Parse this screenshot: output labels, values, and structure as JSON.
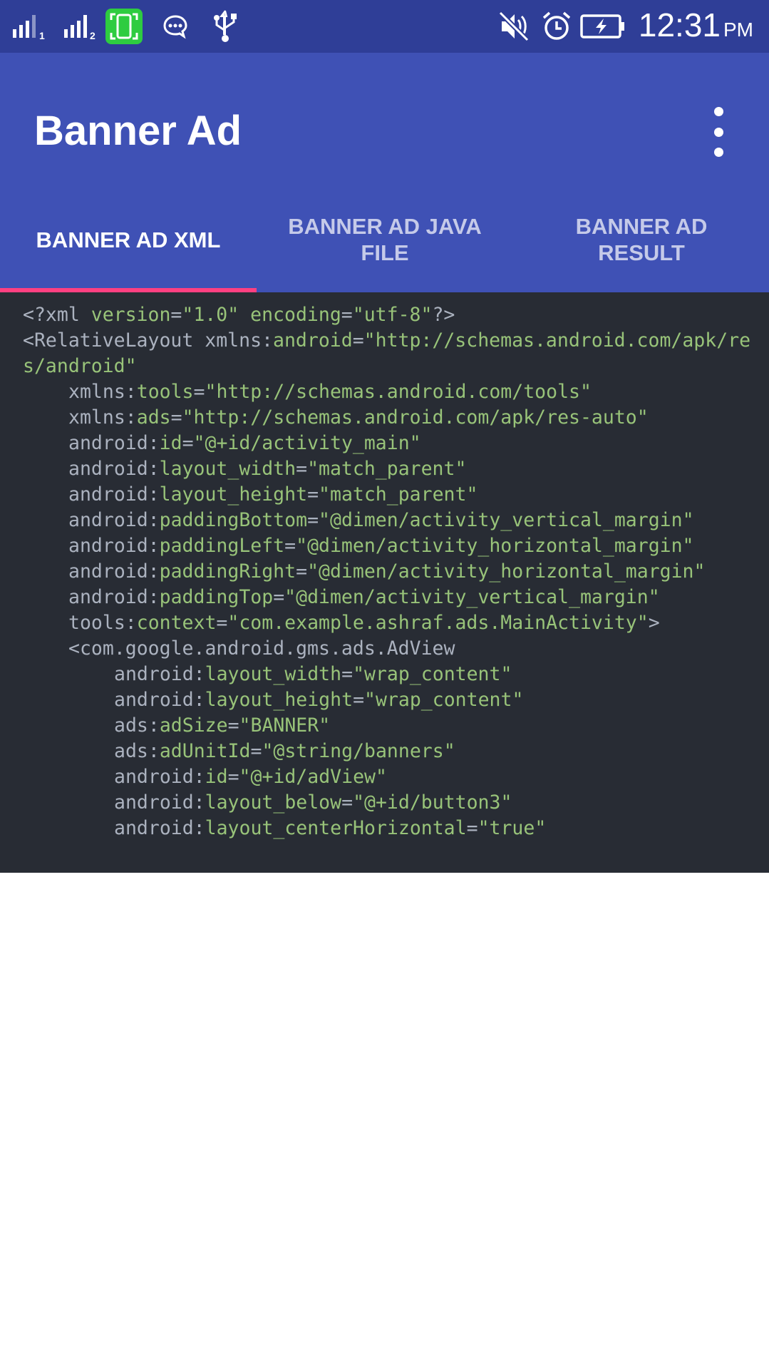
{
  "status_bar": {
    "time": "12:31",
    "ampm": "PM",
    "icons": [
      "signal-1-icon",
      "signal-2-icon",
      "screen-mirror-icon",
      "message-icon",
      "usb-icon",
      "mute-icon",
      "alarm-icon",
      "battery-charging-icon"
    ]
  },
  "app_bar": {
    "title": "Banner Ad",
    "menu_icon": "more-vert-icon"
  },
  "tabs": [
    {
      "label": "BANNER AD XML",
      "active": true
    },
    {
      "label": "BANNER AD JAVA\nFILE",
      "active": false
    },
    {
      "label": "BANNER AD\nRESULT",
      "active": false
    }
  ],
  "colors": {
    "status_bar": "#2f3e97",
    "app_bar": "#3f51b5",
    "tab_indicator": "#ff4081",
    "code_bg": "#282c34",
    "code_text": "#abb2bf",
    "code_attr": "#98c379"
  },
  "code_lines": [
    {
      "indent": "",
      "parts": [
        [
          "plain",
          "<?xml "
        ],
        [
          "attr",
          "version"
        ],
        [
          "plain",
          "="
        ],
        [
          "val",
          "\"1.0\""
        ],
        [
          "plain",
          " "
        ],
        [
          "attr",
          "encoding"
        ],
        [
          "plain",
          "="
        ],
        [
          "val",
          "\"utf-8\""
        ],
        [
          "plain",
          "?>"
        ]
      ]
    },
    {
      "indent": "",
      "parts": [
        [
          "plain",
          "<RelativeLayout xmlns:"
        ],
        [
          "attr",
          "android"
        ],
        [
          "plain",
          "="
        ],
        [
          "val",
          "\"http://schemas.android.com/apk/res/android\""
        ]
      ]
    },
    {
      "indent": "    ",
      "parts": [
        [
          "plain",
          "xmlns:"
        ],
        [
          "attr",
          "tools"
        ],
        [
          "plain",
          "="
        ],
        [
          "val",
          "\"http://schemas.android.com/tools\""
        ]
      ]
    },
    {
      "indent": "    ",
      "parts": [
        [
          "plain",
          "xmlns:"
        ],
        [
          "attr",
          "ads"
        ],
        [
          "plain",
          "="
        ],
        [
          "val",
          "\"http://schemas.android.com/apk/res-auto\""
        ]
      ]
    },
    {
      "indent": "    ",
      "parts": [
        [
          "plain",
          "android:"
        ],
        [
          "attr",
          "id"
        ],
        [
          "plain",
          "="
        ],
        [
          "val",
          "\"@+id/activity_main\""
        ]
      ]
    },
    {
      "indent": "    ",
      "parts": [
        [
          "plain",
          "android:"
        ],
        [
          "attr",
          "layout_width"
        ],
        [
          "plain",
          "="
        ],
        [
          "val",
          "\"match_parent\""
        ]
      ]
    },
    {
      "indent": "    ",
      "parts": [
        [
          "plain",
          "android:"
        ],
        [
          "attr",
          "layout_height"
        ],
        [
          "plain",
          "="
        ],
        [
          "val",
          "\"match_parent\""
        ]
      ]
    },
    {
      "indent": "    ",
      "parts": [
        [
          "plain",
          "android:"
        ],
        [
          "attr",
          "paddingBottom"
        ],
        [
          "plain",
          "="
        ],
        [
          "val",
          "\"@dimen/activity_vertical_margin\""
        ]
      ]
    },
    {
      "indent": "    ",
      "parts": [
        [
          "plain",
          "android:"
        ],
        [
          "attr",
          "paddingLeft"
        ],
        [
          "plain",
          "="
        ],
        [
          "val",
          "\"@dimen/activity_horizontal_margin\""
        ]
      ]
    },
    {
      "indent": "    ",
      "parts": [
        [
          "plain",
          "android:"
        ],
        [
          "attr",
          "paddingRight"
        ],
        [
          "plain",
          "="
        ],
        [
          "val",
          "\"@dimen/activity_horizontal_margin\""
        ]
      ]
    },
    {
      "indent": "    ",
      "parts": [
        [
          "plain",
          "android:"
        ],
        [
          "attr",
          "paddingTop"
        ],
        [
          "plain",
          "="
        ],
        [
          "val",
          "\"@dimen/activity_vertical_margin\""
        ]
      ]
    },
    {
      "indent": "    ",
      "parts": [
        [
          "plain",
          "tools:"
        ],
        [
          "attr",
          "context"
        ],
        [
          "plain",
          "="
        ],
        [
          "val",
          "\"com.example.ashraf.ads.MainActivity\""
        ],
        [
          "plain",
          ">"
        ]
      ]
    },
    {
      "indent": "    ",
      "parts": [
        [
          "plain",
          "<com.google.android.gms.ads.AdView"
        ]
      ]
    },
    {
      "indent": "        ",
      "parts": [
        [
          "plain",
          "android:"
        ],
        [
          "attr",
          "layout_width"
        ],
        [
          "plain",
          "="
        ],
        [
          "val",
          "\"wrap_content\""
        ]
      ]
    },
    {
      "indent": "        ",
      "parts": [
        [
          "plain",
          "android:"
        ],
        [
          "attr",
          "layout_height"
        ],
        [
          "plain",
          "="
        ],
        [
          "val",
          "\"wrap_content\""
        ]
      ]
    },
    {
      "indent": "        ",
      "parts": [
        [
          "plain",
          "ads:"
        ],
        [
          "attr",
          "adSize"
        ],
        [
          "plain",
          "="
        ],
        [
          "val",
          "\"BANNER\""
        ]
      ]
    },
    {
      "indent": "        ",
      "parts": [
        [
          "plain",
          "ads:"
        ],
        [
          "attr",
          "adUnitId"
        ],
        [
          "plain",
          "="
        ],
        [
          "val",
          "\"@string/banners\""
        ]
      ]
    },
    {
      "indent": "        ",
      "parts": [
        [
          "plain",
          "android:"
        ],
        [
          "attr",
          "id"
        ],
        [
          "plain",
          "="
        ],
        [
          "val",
          "\"@+id/adView\""
        ]
      ]
    },
    {
      "indent": "        ",
      "parts": [
        [
          "plain",
          "android:"
        ],
        [
          "attr",
          "layout_below"
        ],
        [
          "plain",
          "="
        ],
        [
          "val",
          "\"@+id/button3\""
        ]
      ]
    },
    {
      "indent": "        ",
      "parts": [
        [
          "plain",
          "android:"
        ],
        [
          "attr",
          "layout_centerHorizontal"
        ],
        [
          "plain",
          "="
        ],
        [
          "val",
          "\"true\""
        ]
      ]
    }
  ]
}
